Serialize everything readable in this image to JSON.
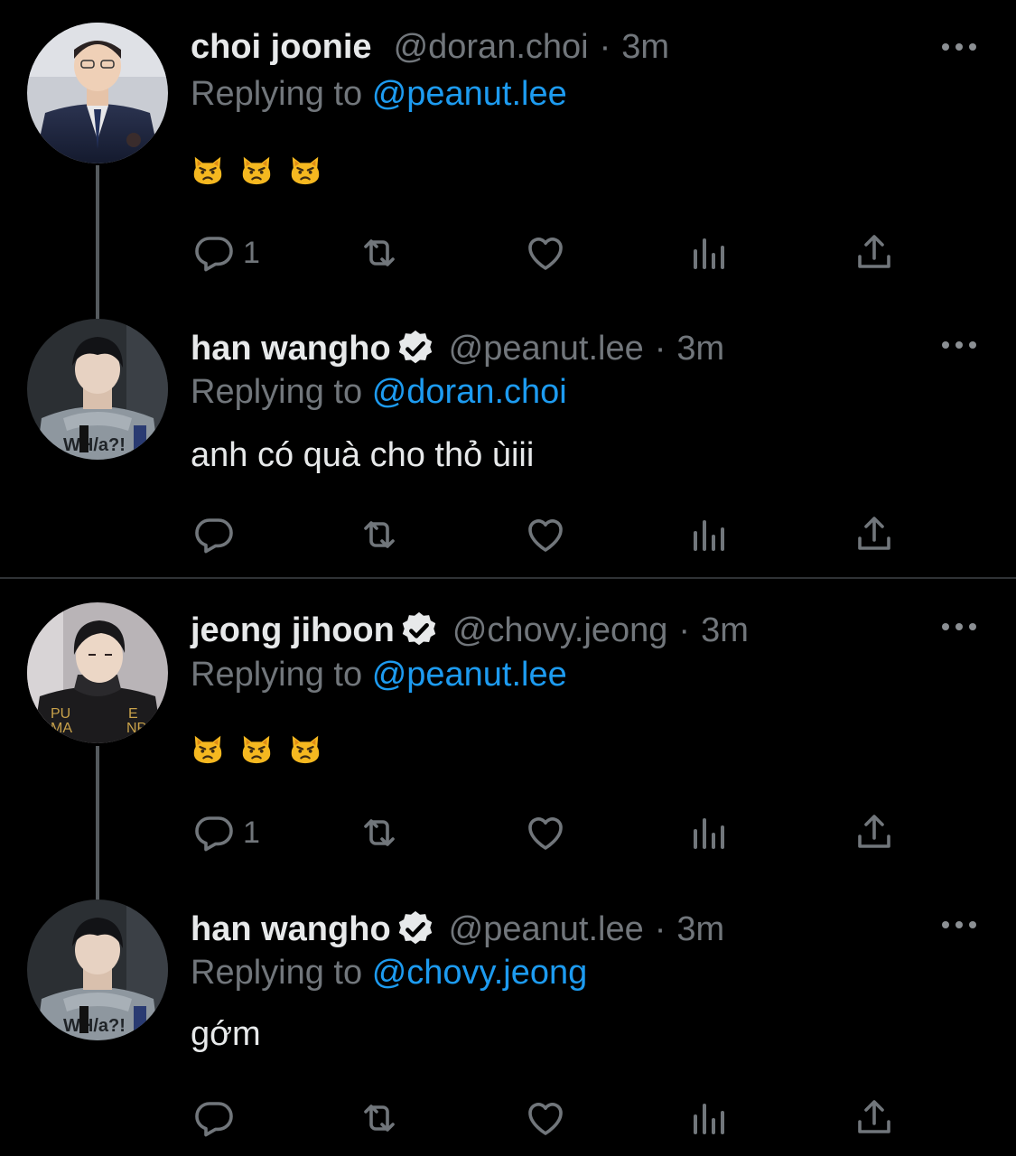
{
  "tweets": [
    {
      "name": "choi joonie",
      "verified": false,
      "handle": "@doran.choi",
      "sep": "·",
      "time": "3m",
      "replying_prefix": "Replying to",
      "replying_to": "@peanut.lee",
      "text": "",
      "emojis": [
        "pouting-cat",
        "pouting-cat",
        "pouting-cat"
      ],
      "reply_count": "1"
    },
    {
      "name": "han wangho",
      "verified": true,
      "handle": "@peanut.lee",
      "sep": "·",
      "time": "3m",
      "replying_prefix": "Replying to",
      "replying_to": "@doran.choi",
      "text": "anh có quà cho thỏ ùiii",
      "emojis": [],
      "reply_count": ""
    },
    {
      "name": "jeong jihoon",
      "verified": true,
      "handle": "@chovy.jeong",
      "sep": "·",
      "time": "3m",
      "replying_prefix": "Replying to",
      "replying_to": "@peanut.lee",
      "text": "",
      "emojis": [
        "pouting-cat",
        "pouting-cat",
        "pouting-cat"
      ],
      "reply_count": "1"
    },
    {
      "name": "han wangho",
      "verified": true,
      "handle": "@peanut.lee",
      "sep": "·",
      "time": "3m",
      "replying_prefix": "Replying to",
      "replying_to": "@chovy.jeong",
      "text": "gớm",
      "emojis": [],
      "reply_count": ""
    }
  ],
  "icons": {
    "reply": "reply-icon",
    "retweet": "retweet-icon",
    "like": "heart-icon",
    "stats": "analytics-icon",
    "share": "share-icon",
    "more": "more-icon",
    "verified": "verified-badge-icon"
  },
  "colors": {
    "background": "#000000",
    "text": "#e7e9ea",
    "secondary": "#71767b",
    "link": "#1d9bf0",
    "divider": "#2f3336",
    "thread_line": "#555a5e"
  }
}
